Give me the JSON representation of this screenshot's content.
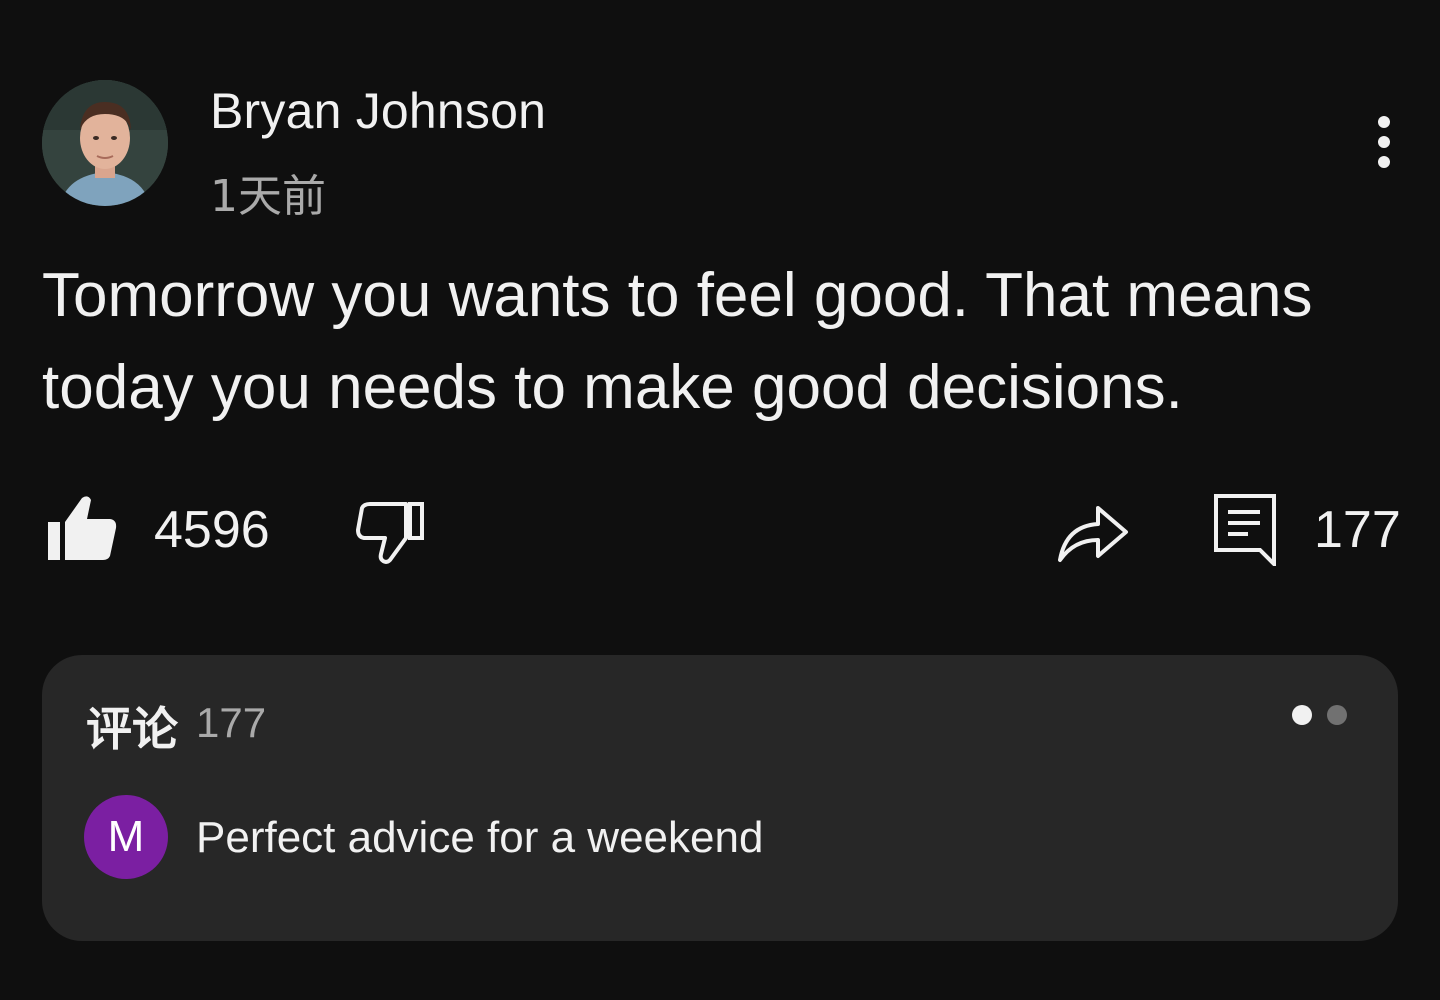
{
  "post": {
    "author": "Bryan Johnson",
    "time": "1天前",
    "text": "Tomorrow you wants to feel good. That means today you needs to make good decisions.",
    "menu_icon": "more-vert-icon"
  },
  "actions": {
    "like_icon": "thumb-up-filled-icon",
    "like_count": "4596",
    "dislike_icon": "thumb-down-outline-icon",
    "share_icon": "share-arrow-icon",
    "comment_icon": "comment-icon",
    "comment_count": "177"
  },
  "comments": {
    "title": "评论",
    "count": "177",
    "pager": {
      "pages": 2,
      "active": 1
    },
    "preview": {
      "avatar_letter": "M",
      "avatar_color": "#7b1fa2",
      "text": "Perfect advice for a weekend"
    }
  },
  "colors": {
    "background": "#0f0f0f",
    "card": "#272727",
    "text": "#f1f1f1",
    "secondary_text": "#aaaaaa"
  }
}
